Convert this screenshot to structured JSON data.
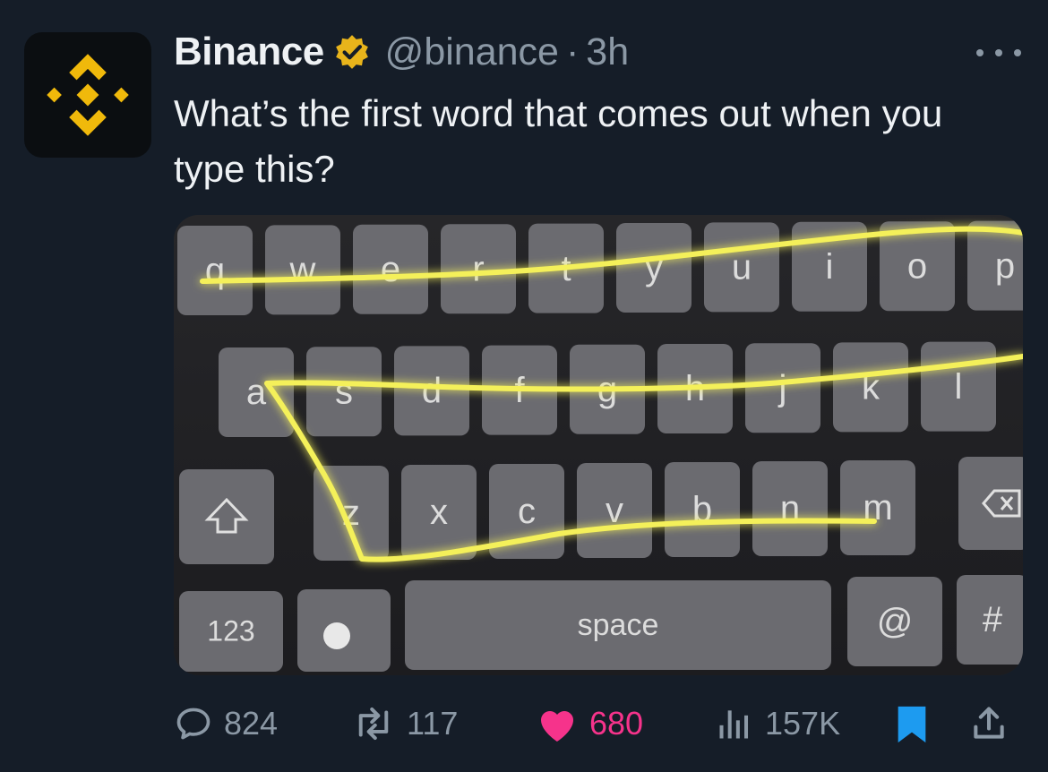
{
  "tweet": {
    "author_name": "Binance",
    "handle": "@binance",
    "separator": "·",
    "time": "3h",
    "text": "What’s the first word that comes out when you type this?"
  },
  "image": {
    "keyboard_rows": [
      [
        "q",
        "w",
        "e",
        "r",
        "t",
        "y",
        "u",
        "i",
        "o",
        "p"
      ],
      [
        "a",
        "s",
        "d",
        "f",
        "g",
        "h",
        "j",
        "k",
        "l"
      ],
      [
        "z",
        "x",
        "c",
        "v",
        "b",
        "n",
        "m"
      ]
    ],
    "numbers_key": "123",
    "space_key": "space",
    "at_key": "@",
    "hash_key": "#",
    "swipe_color": "#f4f05a"
  },
  "actions": {
    "replies": "824",
    "retweets": "117",
    "likes": "680",
    "views": "157K"
  },
  "colors": {
    "background": "#151d28",
    "brand_yellow": "#f0b90b",
    "like_pink": "#f6338b",
    "bookmark_blue": "#1d9bf0",
    "muted_gray": "#8b98a5"
  },
  "icons": [
    "binance-logo-icon",
    "verified-badge-icon",
    "more-icon",
    "reply-icon",
    "retweet-icon",
    "heart-icon",
    "views-icon",
    "bookmark-icon",
    "share-icon"
  ]
}
